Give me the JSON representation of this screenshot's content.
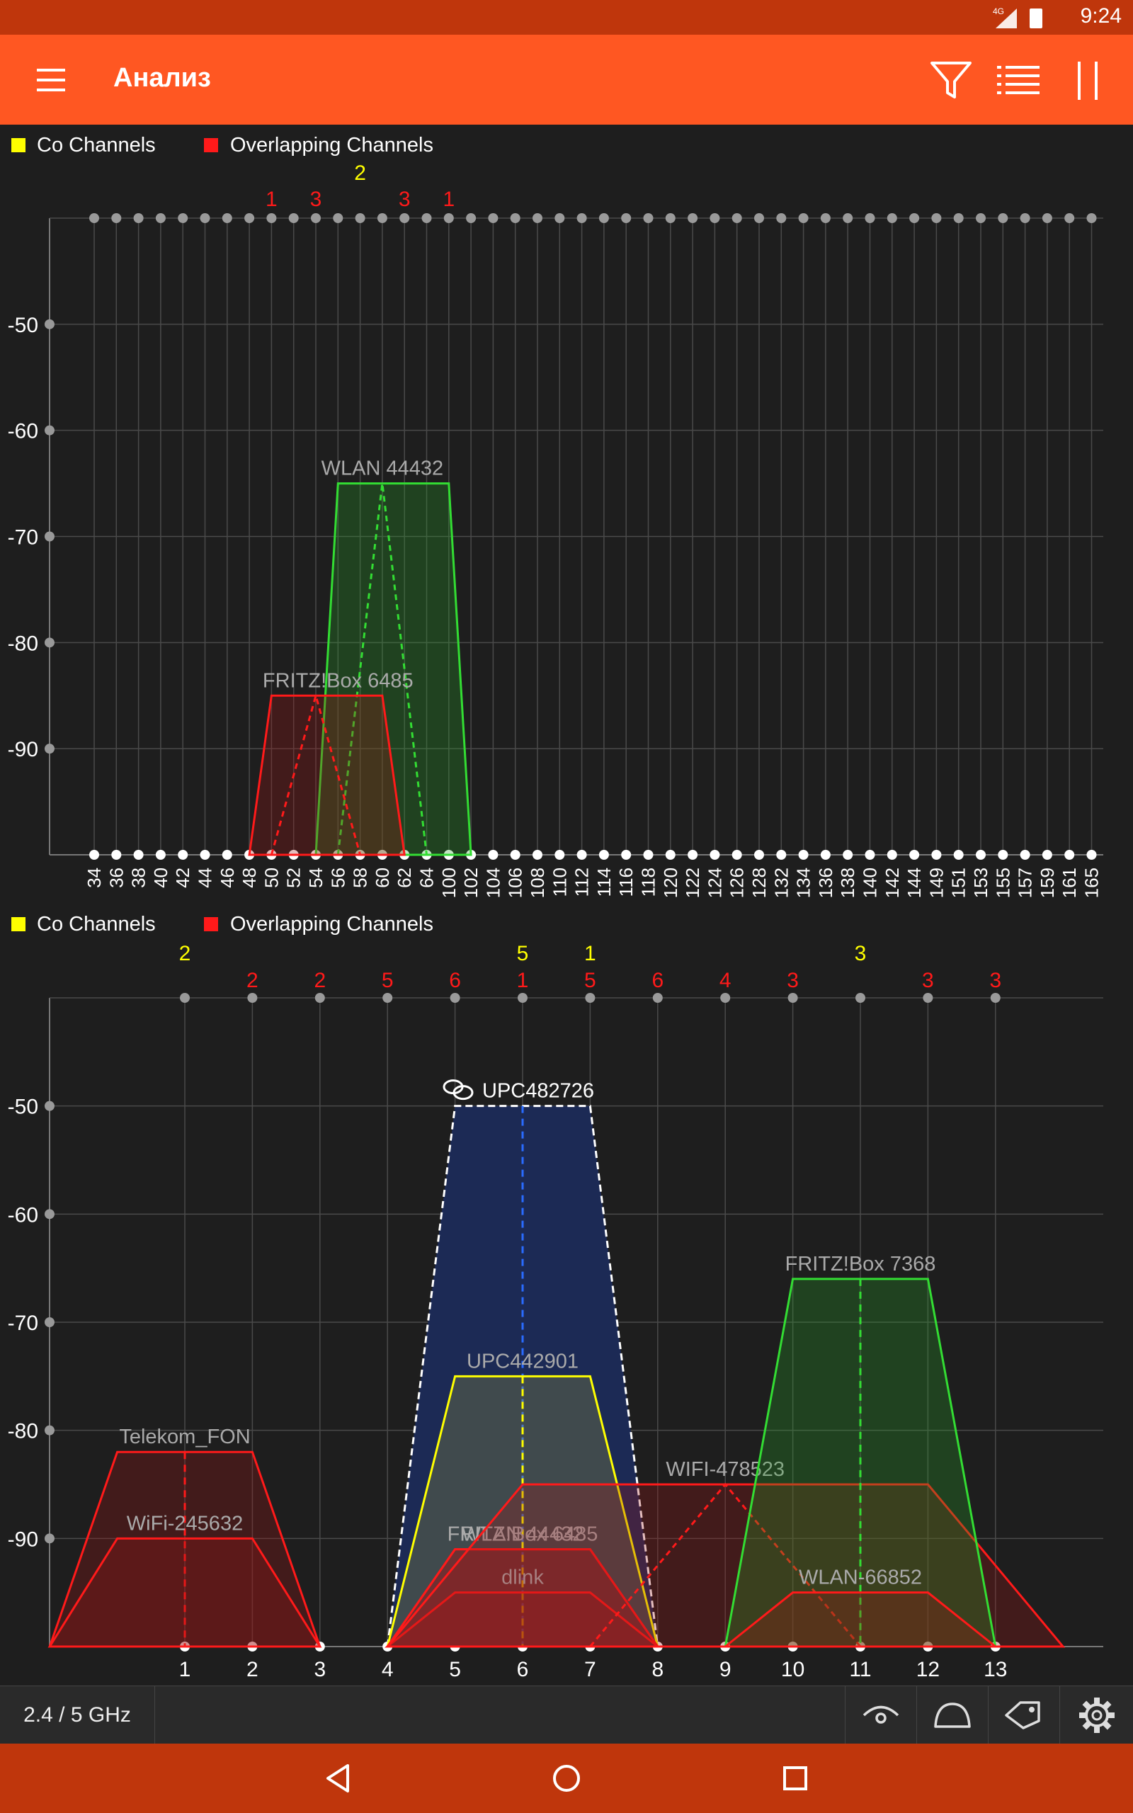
{
  "status_bar": {
    "time": "9:24",
    "network": "4G"
  },
  "app_bar": {
    "title": "Анализ",
    "icons": [
      "menu-icon",
      "filter-icon",
      "list-icon",
      "pause-icon"
    ]
  },
  "colors": {
    "co": "#ffff00",
    "overlap": "#ff1a1a",
    "accent": "#ff5722",
    "dark_accent": "#bf360c"
  },
  "legend": {
    "co": "Co Channels",
    "overlap": "Overlapping Channels"
  },
  "chart_data": [
    {
      "type": "area",
      "band": "5 GHz",
      "channels": [
        34,
        36,
        38,
        40,
        42,
        44,
        46,
        48,
        50,
        52,
        54,
        56,
        58,
        60,
        62,
        64,
        100,
        102,
        104,
        106,
        108,
        110,
        112,
        114,
        116,
        118,
        120,
        122,
        124,
        126,
        128,
        132,
        134,
        136,
        138,
        140,
        142,
        144,
        149,
        151,
        153,
        155,
        157,
        159,
        161,
        165
      ],
      "ylim": [
        -100,
        -40
      ],
      "yticks": [
        -50,
        -60,
        -70,
        -80,
        -90
      ],
      "counts": [
        {
          "channel": 50,
          "value": "1",
          "kind": "overlap"
        },
        {
          "channel": 54,
          "value": "3",
          "kind": "overlap"
        },
        {
          "channel": 58,
          "value": "2",
          "kind": "co"
        },
        {
          "channel": 62,
          "value": "3",
          "kind": "overlap"
        },
        {
          "channel": 100,
          "value": "1",
          "kind": "overlap"
        }
      ],
      "networks": [
        {
          "ssid": "WLAN 44432",
          "from": 56,
          "to": 100,
          "dbm": -65,
          "color": "#33dd33",
          "center": 60,
          "label_at": 60
        },
        {
          "ssid": "FRITZ!Box 6485",
          "from": 50,
          "to": 60,
          "dbm": -85,
          "color": "#ff1a1a",
          "center": 54,
          "label_at": 56
        }
      ]
    },
    {
      "type": "area",
      "band": "2.4 GHz",
      "channels": [
        1,
        2,
        3,
        4,
        5,
        6,
        7,
        8,
        9,
        10,
        11,
        12,
        13
      ],
      "ylim": [
        -100,
        -40
      ],
      "yticks": [
        -50,
        -60,
        -70,
        -80,
        -90
      ],
      "counts": [
        {
          "channel": 1,
          "value": "2",
          "kind": "co"
        },
        {
          "channel": 2,
          "value": "2",
          "kind": "overlap"
        },
        {
          "channel": 3,
          "value": "2",
          "kind": "overlap"
        },
        {
          "channel": 4,
          "value": "5",
          "kind": "overlap"
        },
        {
          "channel": 5,
          "value": "6",
          "kind": "overlap"
        },
        {
          "channel": 6,
          "value": "5",
          "kind": "co"
        },
        {
          "channel": 6,
          "value": "1",
          "kind": "overlap"
        },
        {
          "channel": 7,
          "value": "1",
          "kind": "co"
        },
        {
          "channel": 7,
          "value": "5",
          "kind": "overlap"
        },
        {
          "channel": 8,
          "value": "6",
          "kind": "overlap"
        },
        {
          "channel": 9,
          "value": "4",
          "kind": "overlap"
        },
        {
          "channel": 10,
          "value": "3",
          "kind": "overlap"
        },
        {
          "channel": 11,
          "value": "3",
          "kind": "co"
        },
        {
          "channel": 12,
          "value": "3",
          "kind": "overlap"
        },
        {
          "channel": 13,
          "value": "3",
          "kind": "overlap"
        }
      ],
      "networks": [
        {
          "ssid": "Telekom_FON",
          "center": 1,
          "dbm": -82,
          "color": "#ff1a1a"
        },
        {
          "ssid": "WiFi-245632",
          "center": 1,
          "dbm": -90,
          "color": "#ff1a1a"
        },
        {
          "ssid": "UPC482726",
          "center": 6,
          "dbm": -50,
          "color": "#ffffff",
          "fill": "#1c2a55",
          "dashed": true,
          "connected": true
        },
        {
          "ssid": "UPC442901",
          "center": 6,
          "dbm": -75,
          "color": "#ffff00"
        },
        {
          "ssid": "FRITZ!Box 6485",
          "center": 6,
          "dbm": -91,
          "color": "#ff1a1a"
        },
        {
          "ssid": "WLAN 44432",
          "center": 6,
          "dbm": -91,
          "color": "#ff1a1a"
        },
        {
          "ssid": "dlink",
          "center": 6,
          "dbm": -95,
          "color": "#ff1a1a"
        },
        {
          "ssid": "WIFI-478523",
          "center": 9,
          "dbm": -85,
          "color": "#ff1a1a",
          "wide": true
        },
        {
          "ssid": "FRITZ!Box 7368",
          "center": 11,
          "dbm": -66,
          "color": "#33dd33"
        },
        {
          "ssid": "WLAN-66852",
          "center": 11,
          "dbm": -95,
          "color": "#ff1a1a"
        }
      ]
    }
  ],
  "bottom_bar": {
    "band_button": "2.4 / 5 GHz",
    "icons": [
      "eye-icon",
      "dome-icon",
      "tag-icon",
      "gear-icon"
    ]
  },
  "nav_bar": {
    "icons": [
      "back-icon",
      "home-icon",
      "recents-icon"
    ]
  }
}
